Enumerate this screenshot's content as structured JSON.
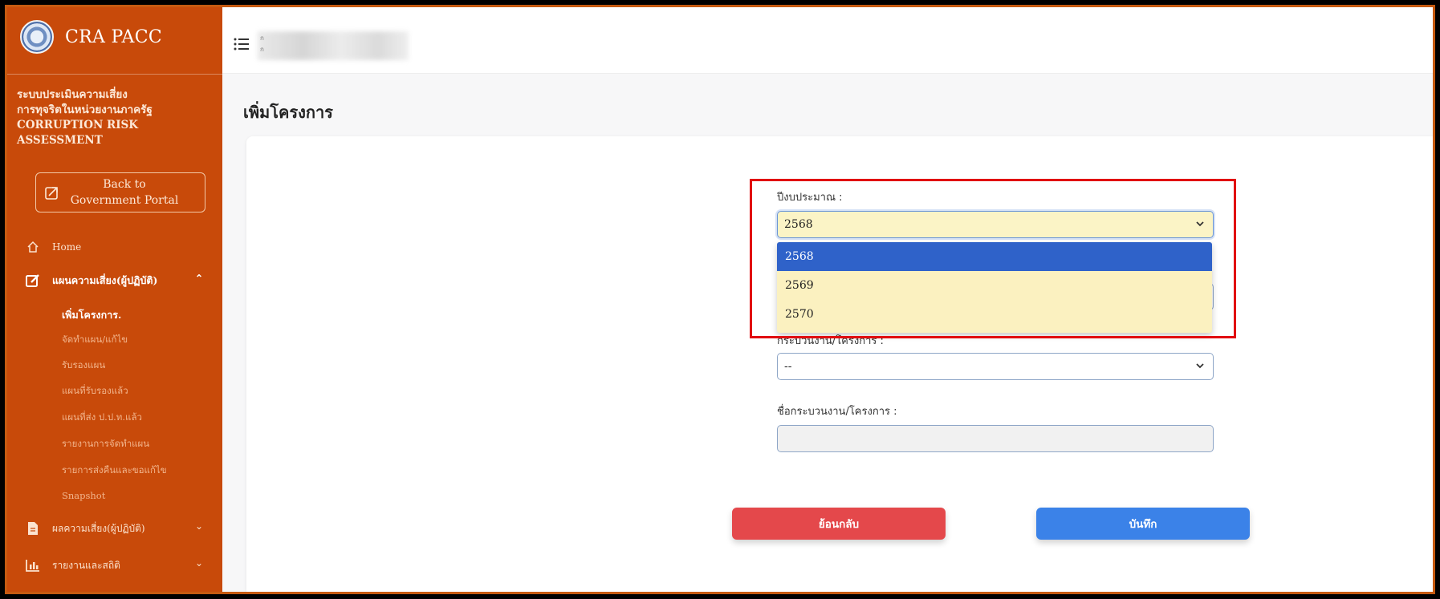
{
  "brand": {
    "name": "CRA PACC"
  },
  "sidebar": {
    "system_title": [
      "ระบบประเมินความเสี่ยง",
      "การทุจริตในหน่วยงานภาครัฐ",
      "CORRUPTION RISK",
      "ASSESSMENT"
    ],
    "back_portal_label": "Back to Government Portal",
    "home_label": "Home",
    "plan_group_label": "แผนความเสี่ยง(ผู้ปฏิบัติ)",
    "plan_subitems": [
      "เพิ่มโครงการ.",
      "จัดทำแผน/แก้ไข",
      "รับรองแผน",
      "แผนที่รับรองแล้ว",
      "แผนที่ส่ง ป.ป.ท.แล้ว",
      "รายงานการจัดทำแผน",
      "รายการส่งคืนและขอแก้ไข",
      "Snapshot"
    ],
    "result_group_label": "ผลความเสี่ยง(ผู้ปฏิบัติ)",
    "report_group_label": "รายงานและสถิติ"
  },
  "topbar": {
    "user_line1": "ก",
    "user_line2": "ก"
  },
  "page": {
    "title": "เพิ่มโครงการ"
  },
  "form": {
    "fiscal_year_label": "ปีงบประมาณ :",
    "fiscal_year_value": "2568",
    "fiscal_year_options": [
      "2568",
      "2569",
      "2570"
    ],
    "process_type_label": "กระบวนงาน/โครงการ :",
    "process_type_value": "--",
    "process_name_label": "ชื่อกระบวนงาน/โครงการ :",
    "process_name_value": ""
  },
  "buttons": {
    "back_label": "ย้อนกลับ",
    "save_label": "บันทึก"
  },
  "colors": {
    "sidebar": "#c84a0a",
    "back_button": "#e4484b",
    "save_button": "#3b82e8",
    "highlight": "#e10d10",
    "selected_option": "#2f62c9"
  }
}
